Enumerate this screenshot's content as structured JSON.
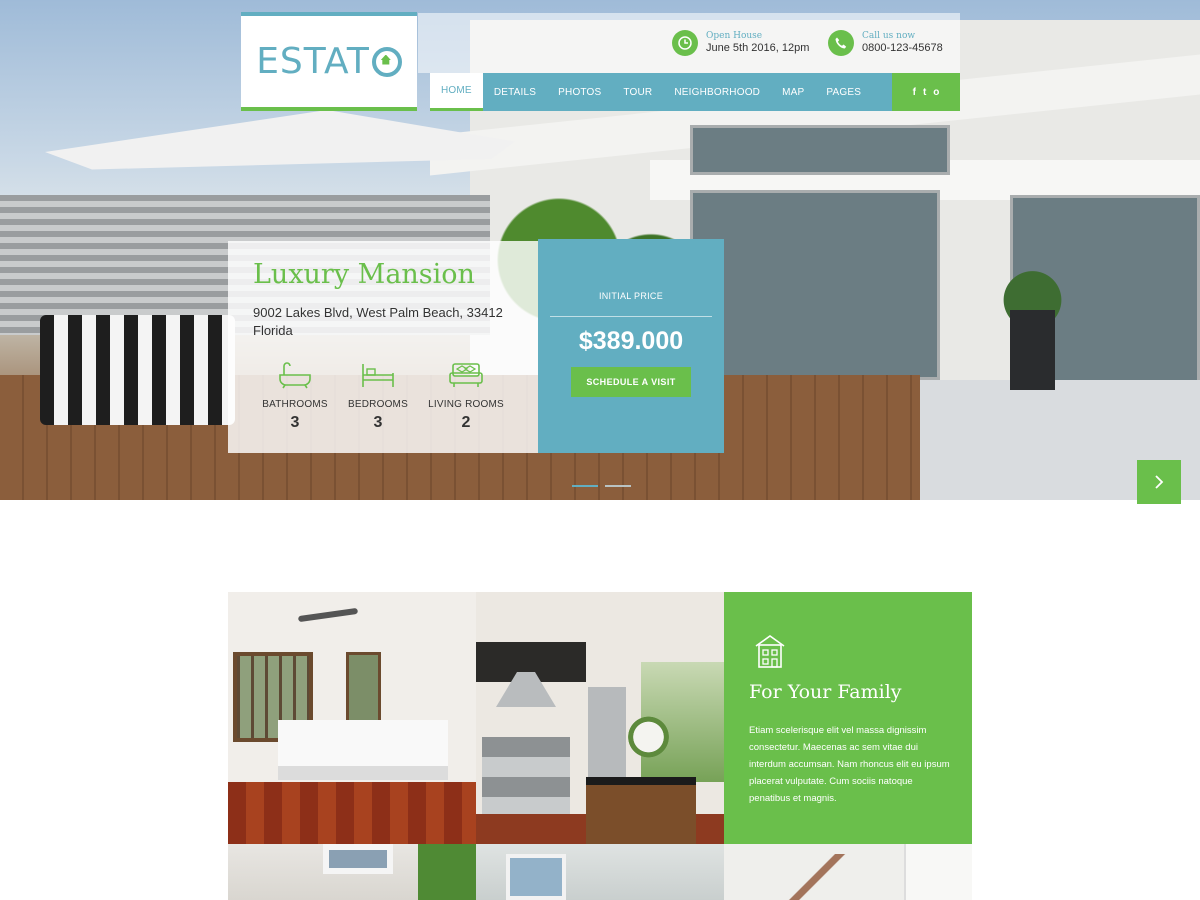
{
  "brand": {
    "logo_text": "ESTAT",
    "accent": "#62aec1",
    "green": "#6abf4b"
  },
  "header": {
    "open_house": {
      "label": "Open House",
      "value": "June 5th 2016, 12pm",
      "icon": "clock-icon"
    },
    "call": {
      "label": "Call us now",
      "value": "0800-123-45678",
      "icon": "phone-icon"
    }
  },
  "nav": {
    "items": [
      "HOME",
      "DETAILS",
      "PHOTOS",
      "TOUR",
      "NEIGHBORHOOD",
      "MAP",
      "PAGES"
    ],
    "active": "HOME",
    "social": [
      "facebook-icon",
      "twitter-icon",
      "instagram-icon"
    ],
    "social_glyphs": [
      "f",
      "t",
      "o"
    ]
  },
  "property": {
    "title": "Luxury Mansion",
    "address": "9002 Lakes Blvd, West Palm Beach, 33412 Florida",
    "features": [
      {
        "label": "BATHROOMS",
        "value": "3",
        "icon": "bathtub-icon"
      },
      {
        "label": "BEDROOMS",
        "value": "3",
        "icon": "bed-icon"
      },
      {
        "label": "LIVING ROOMS",
        "value": "2",
        "icon": "sofa-icon"
      }
    ]
  },
  "price": {
    "label": "INITIAL PRICE",
    "value": "$389.000",
    "button": "SCHEDULE A VISIT"
  },
  "slider": {
    "count": 2,
    "active": 0
  },
  "family": {
    "title": "For Your Family",
    "text": "Etiam scelerisque elit vel massa dignissim consectetur. Maecenas ac sem vitae dui interdum accumsan. Nam rhoncus elit eu ipsum placerat vulputate. Cum sociis natoque penatibus et magnis.",
    "icon": "house-icon"
  }
}
